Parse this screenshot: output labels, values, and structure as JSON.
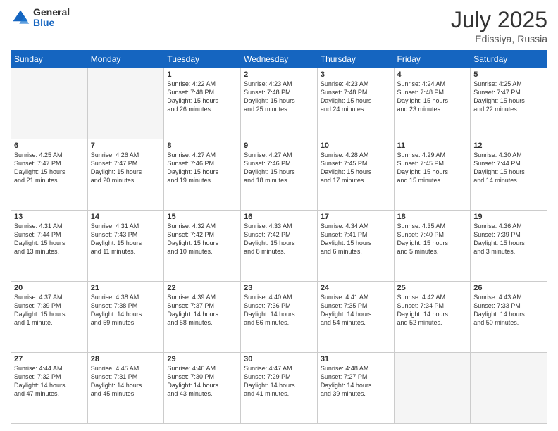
{
  "header": {
    "logo_general": "General",
    "logo_blue": "Blue",
    "month_title": "July 2025",
    "location": "Edissiya, Russia"
  },
  "days_of_week": [
    "Sunday",
    "Monday",
    "Tuesday",
    "Wednesday",
    "Thursday",
    "Friday",
    "Saturday"
  ],
  "weeks": [
    [
      {
        "day": "",
        "info": ""
      },
      {
        "day": "",
        "info": ""
      },
      {
        "day": "1",
        "info": "Sunrise: 4:22 AM\nSunset: 7:48 PM\nDaylight: 15 hours\nand 26 minutes."
      },
      {
        "day": "2",
        "info": "Sunrise: 4:23 AM\nSunset: 7:48 PM\nDaylight: 15 hours\nand 25 minutes."
      },
      {
        "day": "3",
        "info": "Sunrise: 4:23 AM\nSunset: 7:48 PM\nDaylight: 15 hours\nand 24 minutes."
      },
      {
        "day": "4",
        "info": "Sunrise: 4:24 AM\nSunset: 7:48 PM\nDaylight: 15 hours\nand 23 minutes."
      },
      {
        "day": "5",
        "info": "Sunrise: 4:25 AM\nSunset: 7:47 PM\nDaylight: 15 hours\nand 22 minutes."
      }
    ],
    [
      {
        "day": "6",
        "info": "Sunrise: 4:25 AM\nSunset: 7:47 PM\nDaylight: 15 hours\nand 21 minutes."
      },
      {
        "day": "7",
        "info": "Sunrise: 4:26 AM\nSunset: 7:47 PM\nDaylight: 15 hours\nand 20 minutes."
      },
      {
        "day": "8",
        "info": "Sunrise: 4:27 AM\nSunset: 7:46 PM\nDaylight: 15 hours\nand 19 minutes."
      },
      {
        "day": "9",
        "info": "Sunrise: 4:27 AM\nSunset: 7:46 PM\nDaylight: 15 hours\nand 18 minutes."
      },
      {
        "day": "10",
        "info": "Sunrise: 4:28 AM\nSunset: 7:45 PM\nDaylight: 15 hours\nand 17 minutes."
      },
      {
        "day": "11",
        "info": "Sunrise: 4:29 AM\nSunset: 7:45 PM\nDaylight: 15 hours\nand 15 minutes."
      },
      {
        "day": "12",
        "info": "Sunrise: 4:30 AM\nSunset: 7:44 PM\nDaylight: 15 hours\nand 14 minutes."
      }
    ],
    [
      {
        "day": "13",
        "info": "Sunrise: 4:31 AM\nSunset: 7:44 PM\nDaylight: 15 hours\nand 13 minutes."
      },
      {
        "day": "14",
        "info": "Sunrise: 4:31 AM\nSunset: 7:43 PM\nDaylight: 15 hours\nand 11 minutes."
      },
      {
        "day": "15",
        "info": "Sunrise: 4:32 AM\nSunset: 7:42 PM\nDaylight: 15 hours\nand 10 minutes."
      },
      {
        "day": "16",
        "info": "Sunrise: 4:33 AM\nSunset: 7:42 PM\nDaylight: 15 hours\nand 8 minutes."
      },
      {
        "day": "17",
        "info": "Sunrise: 4:34 AM\nSunset: 7:41 PM\nDaylight: 15 hours\nand 6 minutes."
      },
      {
        "day": "18",
        "info": "Sunrise: 4:35 AM\nSunset: 7:40 PM\nDaylight: 15 hours\nand 5 minutes."
      },
      {
        "day": "19",
        "info": "Sunrise: 4:36 AM\nSunset: 7:39 PM\nDaylight: 15 hours\nand 3 minutes."
      }
    ],
    [
      {
        "day": "20",
        "info": "Sunrise: 4:37 AM\nSunset: 7:39 PM\nDaylight: 15 hours\nand 1 minute."
      },
      {
        "day": "21",
        "info": "Sunrise: 4:38 AM\nSunset: 7:38 PM\nDaylight: 14 hours\nand 59 minutes."
      },
      {
        "day": "22",
        "info": "Sunrise: 4:39 AM\nSunset: 7:37 PM\nDaylight: 14 hours\nand 58 minutes."
      },
      {
        "day": "23",
        "info": "Sunrise: 4:40 AM\nSunset: 7:36 PM\nDaylight: 14 hours\nand 56 minutes."
      },
      {
        "day": "24",
        "info": "Sunrise: 4:41 AM\nSunset: 7:35 PM\nDaylight: 14 hours\nand 54 minutes."
      },
      {
        "day": "25",
        "info": "Sunrise: 4:42 AM\nSunset: 7:34 PM\nDaylight: 14 hours\nand 52 minutes."
      },
      {
        "day": "26",
        "info": "Sunrise: 4:43 AM\nSunset: 7:33 PM\nDaylight: 14 hours\nand 50 minutes."
      }
    ],
    [
      {
        "day": "27",
        "info": "Sunrise: 4:44 AM\nSunset: 7:32 PM\nDaylight: 14 hours\nand 47 minutes."
      },
      {
        "day": "28",
        "info": "Sunrise: 4:45 AM\nSunset: 7:31 PM\nDaylight: 14 hours\nand 45 minutes."
      },
      {
        "day": "29",
        "info": "Sunrise: 4:46 AM\nSunset: 7:30 PM\nDaylight: 14 hours\nand 43 minutes."
      },
      {
        "day": "30",
        "info": "Sunrise: 4:47 AM\nSunset: 7:29 PM\nDaylight: 14 hours\nand 41 minutes."
      },
      {
        "day": "31",
        "info": "Sunrise: 4:48 AM\nSunset: 7:27 PM\nDaylight: 14 hours\nand 39 minutes."
      },
      {
        "day": "",
        "info": ""
      },
      {
        "day": "",
        "info": ""
      }
    ]
  ]
}
